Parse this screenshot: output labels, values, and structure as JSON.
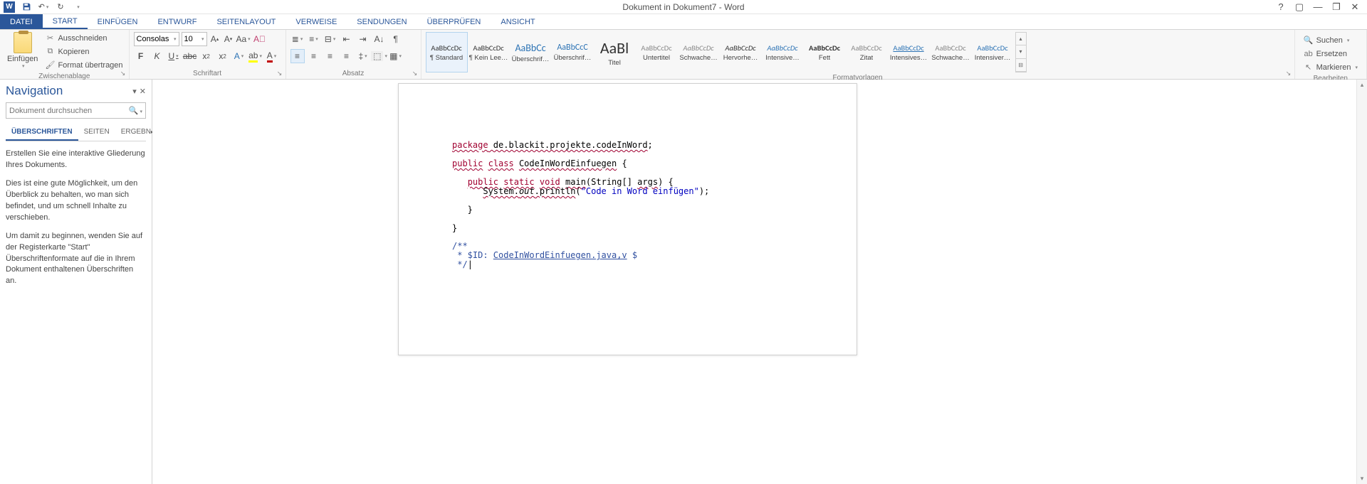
{
  "titlebar": {
    "title": "Dokument in Dokument7 - Word"
  },
  "tabs": {
    "file": "DATEI",
    "items": [
      "START",
      "EINFÜGEN",
      "ENTWURF",
      "SEITENLAYOUT",
      "VERWEISE",
      "SENDUNGEN",
      "ÜBERPRÜFEN",
      "ANSICHT"
    ],
    "activeIndex": 0
  },
  "clipboard": {
    "paste": "Einfügen",
    "cut": "Ausschneiden",
    "copy": "Kopieren",
    "formatPainter": "Format übertragen",
    "group": "Zwischenablage"
  },
  "font": {
    "name": "Consolas",
    "size": "10",
    "group": "Schriftart"
  },
  "paragraph": {
    "group": "Absatz"
  },
  "styles": {
    "group": "Formatvorlagen",
    "items": [
      {
        "preview": "AaBbCcDc",
        "label": "¶ Standard",
        "size": "10.5px",
        "color": "#333",
        "selected": true
      },
      {
        "preview": "AaBbCcDc",
        "label": "¶ Kein Lee…",
        "size": "10.5px",
        "color": "#333"
      },
      {
        "preview": "AaBbCc",
        "label": "Überschrif…",
        "size": "14px",
        "color": "#2e74b5"
      },
      {
        "preview": "AaBbCcC",
        "label": "Überschrif…",
        "size": "12px",
        "color": "#2e74b5"
      },
      {
        "preview": "AaBl",
        "label": "Titel",
        "size": "22px",
        "color": "#333"
      },
      {
        "preview": "AaBbCcDc",
        "label": "Untertitel",
        "size": "10.5px",
        "color": "#888"
      },
      {
        "preview": "AaBbCcDc",
        "label": "Schwache…",
        "size": "10.5px",
        "color": "#888",
        "italic": true
      },
      {
        "preview": "AaBbCcDc",
        "label": "Hervorhe…",
        "size": "10.5px",
        "color": "#333",
        "italic": true
      },
      {
        "preview": "AaBbCcDc",
        "label": "Intensive…",
        "size": "10.5px",
        "color": "#2e74b5",
        "italic": true
      },
      {
        "preview": "AaBbCcDc",
        "label": "Fett",
        "size": "10.5px",
        "color": "#333",
        "bold": true
      },
      {
        "preview": "AaBbCcDc",
        "label": "Zitat",
        "size": "10.5px",
        "color": "#888"
      },
      {
        "preview": "AaBbCcDc",
        "label": "Intensives…",
        "size": "10.5px",
        "color": "#2e74b5",
        "underline": true
      },
      {
        "preview": "AaBbCcDc",
        "label": "Schwache…",
        "size": "10.5px",
        "color": "#888"
      },
      {
        "preview": "AaBbCcDc",
        "label": "Intensiver…",
        "size": "10.5px",
        "color": "#2e74b5"
      }
    ]
  },
  "editing": {
    "find": "Suchen",
    "replace": "Ersetzen",
    "select": "Markieren",
    "group": "Bearbeiten"
  },
  "nav": {
    "title": "Navigation",
    "placeholder": "Dokument durchsuchen",
    "tabs": [
      "ÜBERSCHRIFTEN",
      "SEITEN",
      "ERGEBN"
    ],
    "hint1": "Erstellen Sie eine interaktive Gliederung Ihres Dokuments.",
    "hint2": "Dies ist eine gute Möglichkeit, um den Überblick zu behalten, wo man sich befindet, und um schnell Inhalte zu verschieben.",
    "hint3": "Um damit zu beginnen, wenden Sie auf der Registerkarte \"Start\" Überschriftenformate auf die in Ihrem Dokument enthaltenen Überschriften an."
  },
  "doc": {
    "l1a": "package",
    "l1b": " de.blackit.projekte.codeInWord",
    "l2a": "public",
    "l2b": "class",
    "l2c": "CodeInWordEinfuegen",
    "l3a": "public",
    "l3b": "static",
    "l3c": "void",
    "l3d": "main",
    "l3e": "args",
    "l4a": "System.",
    "l4b": "out",
    "l4c": ".println",
    "l4d": "\"Code in Word einfügen\"",
    "jd1": "/**",
    "jd2": " * $ID: ",
    "jd3": "CodeInWordEinfuegen.java,v",
    "jd4": " $",
    "jd5": " */"
  }
}
